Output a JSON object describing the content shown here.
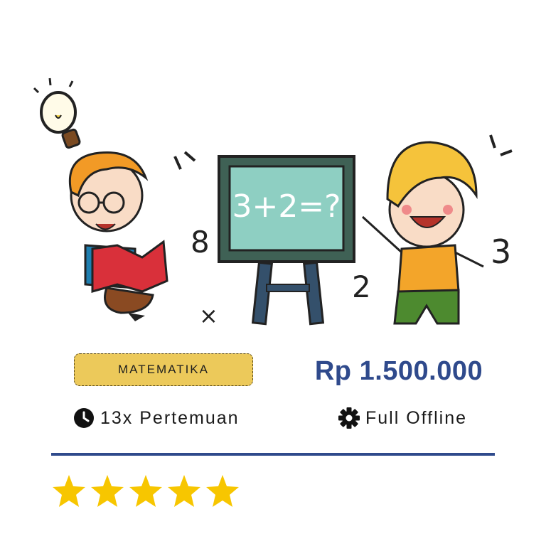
{
  "card": {
    "subject_badge": "MATEMATIKA",
    "price": "Rp 1.500.000",
    "sessions": {
      "icon": "clock-icon",
      "label": "13x Pertemuan"
    },
    "mode": {
      "icon": "gear-icon",
      "label": "Full Offline"
    },
    "rating": {
      "value": 5,
      "max": 5,
      "icon": "star-icon"
    }
  },
  "illustration": {
    "blackboard_text": "3+2=?",
    "floating_numbers": [
      "8",
      "2",
      "3"
    ],
    "floating_symbol": "×"
  },
  "colors": {
    "accent_blue": "#2f4a8c",
    "badge_yellow": "#ecc95a",
    "star_gold": "#f7c600",
    "board_green": "#8ecfc2",
    "board_frame": "#3f6155"
  }
}
